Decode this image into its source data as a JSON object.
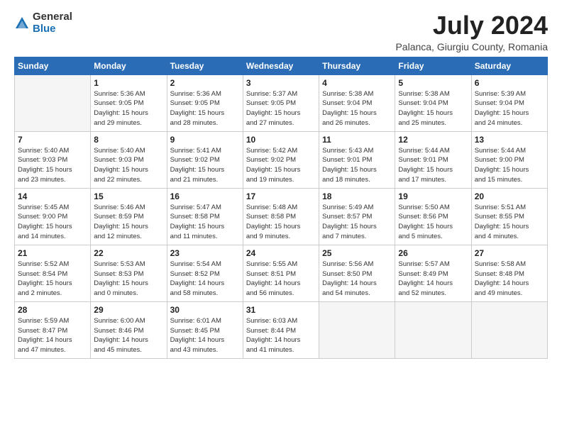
{
  "logo": {
    "general": "General",
    "blue": "Blue"
  },
  "title": "July 2024",
  "subtitle": "Palanca, Giurgiu County, Romania",
  "weekdays": [
    "Sunday",
    "Monday",
    "Tuesday",
    "Wednesday",
    "Thursday",
    "Friday",
    "Saturday"
  ],
  "weeks": [
    [
      {
        "day": "",
        "info": ""
      },
      {
        "day": "1",
        "info": "Sunrise: 5:36 AM\nSunset: 9:05 PM\nDaylight: 15 hours\nand 29 minutes."
      },
      {
        "day": "2",
        "info": "Sunrise: 5:36 AM\nSunset: 9:05 PM\nDaylight: 15 hours\nand 28 minutes."
      },
      {
        "day": "3",
        "info": "Sunrise: 5:37 AM\nSunset: 9:05 PM\nDaylight: 15 hours\nand 27 minutes."
      },
      {
        "day": "4",
        "info": "Sunrise: 5:38 AM\nSunset: 9:04 PM\nDaylight: 15 hours\nand 26 minutes."
      },
      {
        "day": "5",
        "info": "Sunrise: 5:38 AM\nSunset: 9:04 PM\nDaylight: 15 hours\nand 25 minutes."
      },
      {
        "day": "6",
        "info": "Sunrise: 5:39 AM\nSunset: 9:04 PM\nDaylight: 15 hours\nand 24 minutes."
      }
    ],
    [
      {
        "day": "7",
        "info": "Sunrise: 5:40 AM\nSunset: 9:03 PM\nDaylight: 15 hours\nand 23 minutes."
      },
      {
        "day": "8",
        "info": "Sunrise: 5:40 AM\nSunset: 9:03 PM\nDaylight: 15 hours\nand 22 minutes."
      },
      {
        "day": "9",
        "info": "Sunrise: 5:41 AM\nSunset: 9:02 PM\nDaylight: 15 hours\nand 21 minutes."
      },
      {
        "day": "10",
        "info": "Sunrise: 5:42 AM\nSunset: 9:02 PM\nDaylight: 15 hours\nand 19 minutes."
      },
      {
        "day": "11",
        "info": "Sunrise: 5:43 AM\nSunset: 9:01 PM\nDaylight: 15 hours\nand 18 minutes."
      },
      {
        "day": "12",
        "info": "Sunrise: 5:44 AM\nSunset: 9:01 PM\nDaylight: 15 hours\nand 17 minutes."
      },
      {
        "day": "13",
        "info": "Sunrise: 5:44 AM\nSunset: 9:00 PM\nDaylight: 15 hours\nand 15 minutes."
      }
    ],
    [
      {
        "day": "14",
        "info": "Sunrise: 5:45 AM\nSunset: 9:00 PM\nDaylight: 15 hours\nand 14 minutes."
      },
      {
        "day": "15",
        "info": "Sunrise: 5:46 AM\nSunset: 8:59 PM\nDaylight: 15 hours\nand 12 minutes."
      },
      {
        "day": "16",
        "info": "Sunrise: 5:47 AM\nSunset: 8:58 PM\nDaylight: 15 hours\nand 11 minutes."
      },
      {
        "day": "17",
        "info": "Sunrise: 5:48 AM\nSunset: 8:58 PM\nDaylight: 15 hours\nand 9 minutes."
      },
      {
        "day": "18",
        "info": "Sunrise: 5:49 AM\nSunset: 8:57 PM\nDaylight: 15 hours\nand 7 minutes."
      },
      {
        "day": "19",
        "info": "Sunrise: 5:50 AM\nSunset: 8:56 PM\nDaylight: 15 hours\nand 5 minutes."
      },
      {
        "day": "20",
        "info": "Sunrise: 5:51 AM\nSunset: 8:55 PM\nDaylight: 15 hours\nand 4 minutes."
      }
    ],
    [
      {
        "day": "21",
        "info": "Sunrise: 5:52 AM\nSunset: 8:54 PM\nDaylight: 15 hours\nand 2 minutes."
      },
      {
        "day": "22",
        "info": "Sunrise: 5:53 AM\nSunset: 8:53 PM\nDaylight: 15 hours\nand 0 minutes."
      },
      {
        "day": "23",
        "info": "Sunrise: 5:54 AM\nSunset: 8:52 PM\nDaylight: 14 hours\nand 58 minutes."
      },
      {
        "day": "24",
        "info": "Sunrise: 5:55 AM\nSunset: 8:51 PM\nDaylight: 14 hours\nand 56 minutes."
      },
      {
        "day": "25",
        "info": "Sunrise: 5:56 AM\nSunset: 8:50 PM\nDaylight: 14 hours\nand 54 minutes."
      },
      {
        "day": "26",
        "info": "Sunrise: 5:57 AM\nSunset: 8:49 PM\nDaylight: 14 hours\nand 52 minutes."
      },
      {
        "day": "27",
        "info": "Sunrise: 5:58 AM\nSunset: 8:48 PM\nDaylight: 14 hours\nand 49 minutes."
      }
    ],
    [
      {
        "day": "28",
        "info": "Sunrise: 5:59 AM\nSunset: 8:47 PM\nDaylight: 14 hours\nand 47 minutes."
      },
      {
        "day": "29",
        "info": "Sunrise: 6:00 AM\nSunset: 8:46 PM\nDaylight: 14 hours\nand 45 minutes."
      },
      {
        "day": "30",
        "info": "Sunrise: 6:01 AM\nSunset: 8:45 PM\nDaylight: 14 hours\nand 43 minutes."
      },
      {
        "day": "31",
        "info": "Sunrise: 6:03 AM\nSunset: 8:44 PM\nDaylight: 14 hours\nand 41 minutes."
      },
      {
        "day": "",
        "info": ""
      },
      {
        "day": "",
        "info": ""
      },
      {
        "day": "",
        "info": ""
      }
    ]
  ]
}
